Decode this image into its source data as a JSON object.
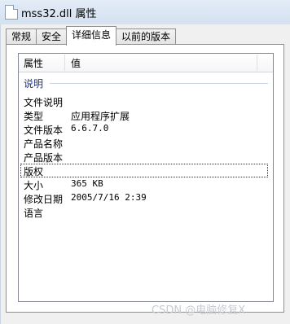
{
  "window": {
    "title": "mss32.dll 属性"
  },
  "tabs": [
    {
      "label": "常规"
    },
    {
      "label": "安全"
    },
    {
      "label": "详细信息"
    },
    {
      "label": "以前的版本"
    }
  ],
  "columns": {
    "property": "属性",
    "value": "值"
  },
  "group": {
    "label": "说明"
  },
  "rows": [
    {
      "key": "文件说明",
      "value": ""
    },
    {
      "key": "类型",
      "value": "应用程序扩展"
    },
    {
      "key": "文件版本",
      "value": "6.6.7.0"
    },
    {
      "key": "产品名称",
      "value": ""
    },
    {
      "key": "产品版本",
      "value": ""
    },
    {
      "key": "版权",
      "value": ""
    },
    {
      "key": "大小",
      "value": "365 KB"
    },
    {
      "key": "修改日期",
      "value": "2005/7/16 2:39"
    },
    {
      "key": "语言",
      "value": ""
    }
  ],
  "watermark": "CSDN @电脑修复X"
}
